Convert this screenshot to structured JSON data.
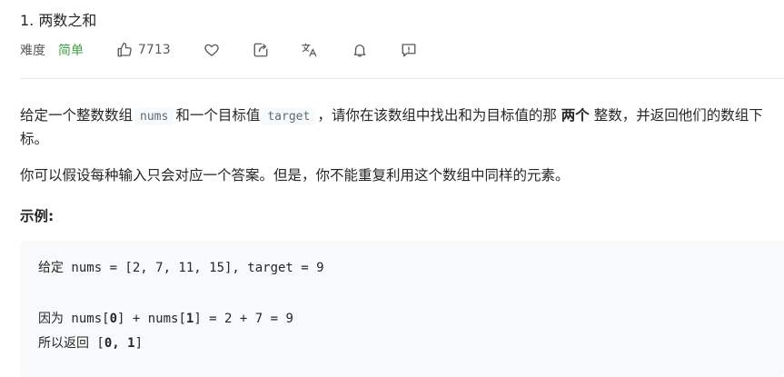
{
  "problem": {
    "title": "1. 两数之和",
    "difficulty_label": "难度",
    "difficulty_value": "简单",
    "likes": "7713"
  },
  "icons": {
    "like": "thumbs-up-icon",
    "favorite": "heart-icon",
    "share": "share-icon",
    "language": "translate-icon",
    "notify": "bell-icon",
    "feedback": "feedback-icon"
  },
  "colors": {
    "easy": "#43a047",
    "code_bg": "#f7f9fa",
    "inline_code": "#546e7a"
  },
  "description": {
    "p1_a": "给定一个整数数组",
    "p1_code1": "nums",
    "p1_b": "和一个目标值",
    "p1_code2": "target",
    "p1_c": "，请你在该数组中找出和为目标值的那",
    "p1_bold": "两个",
    "p1_d": "整数，并返回他们的数组下标。",
    "p2": "你可以假设每种输入只会对应一个答案。但是，你不能重复利用这个数组中同样的元素。",
    "example_heading": "示例:"
  },
  "example": {
    "line1": "给定 nums = [2, 7, 11, 15], target = 9",
    "line2_a": "因为 nums[",
    "line2_b": "0",
    "line2_c": "] + nums[",
    "line2_d": "1",
    "line2_e": "] = 2 + 7 = 9",
    "line3_a": "所以返回 [",
    "line3_b": "0, 1",
    "line3_c": "]"
  }
}
